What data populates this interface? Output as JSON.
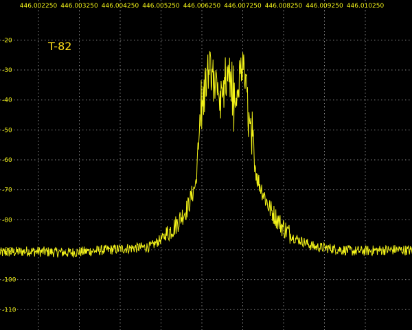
{
  "chart_data": {
    "type": "line",
    "title": "T-82",
    "xlabel": "",
    "ylabel": "",
    "x_tick_labels": [
      "446.002250",
      "446.003250",
      "446.004250",
      "446.005250",
      "446.006250",
      "446.007250",
      "446.008250",
      "446.009250",
      "446.010250"
    ],
    "x_tick_values": [
      446.00225,
      446.00325,
      446.00425,
      446.00525,
      446.00625,
      446.00725,
      446.00825,
      446.00925,
      446.01025
    ],
    "xlim": [
      446.0013,
      446.0117
    ],
    "y_tick_labels": [
      "-20",
      "-30",
      "-40",
      "-50",
      "-60",
      "-70",
      "-80",
      "-90",
      "-100",
      "-110"
    ],
    "y_tick_values": [
      -20,
      -30,
      -40,
      -50,
      -60,
      -70,
      -80,
      -90,
      -100,
      -110
    ],
    "ylim": [
      -120,
      -17
    ],
    "grid": true,
    "series": [
      {
        "x": [
          446.0013,
          446.002,
          446.003,
          446.004,
          446.005,
          446.0053,
          446.0056,
          446.0059,
          446.0061,
          446.0062,
          446.0063,
          446.0064,
          446.0065,
          446.0066,
          446.0067,
          446.0068,
          446.0069,
          446.007,
          446.0071,
          446.0072,
          446.0073,
          446.0074,
          446.0076,
          446.0079,
          446.0082,
          446.0085,
          446.009,
          446.01,
          446.011,
          446.0117
        ],
        "y": [
          -91,
          -90.5,
          -91,
          -90,
          -89,
          -86,
          -82,
          -76,
          -68,
          -50,
          -38,
          -32,
          -28,
          -36,
          -42,
          -38,
          -29,
          -41,
          -44,
          -27,
          -33,
          -48,
          -66,
          -76,
          -82,
          -86,
          -89,
          -90.5,
          -90,
          -90.5
        ]
      }
    ],
    "colors": {
      "background": "#000000",
      "grid": "#8a8a8a",
      "trace": "#f2f219",
      "labels": "#f2f219"
    }
  }
}
